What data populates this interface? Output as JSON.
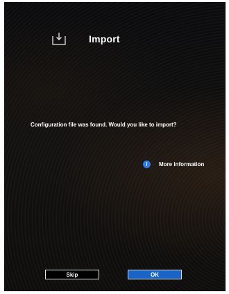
{
  "dialog": {
    "title": "Import",
    "title_icon": "download-tray-icon",
    "message": "Configuration file was found. Would you like to import?",
    "more_info": {
      "icon": "info-icon",
      "icon_glyph": "i",
      "label": "More information"
    },
    "buttons": {
      "skip_label": "Skip",
      "ok_label": "OK"
    }
  },
  "colors": {
    "background": "#0c0c0e",
    "text": "#ffffff",
    "info_accent": "#2e7be6",
    "ok_button": "#1a64c8"
  }
}
